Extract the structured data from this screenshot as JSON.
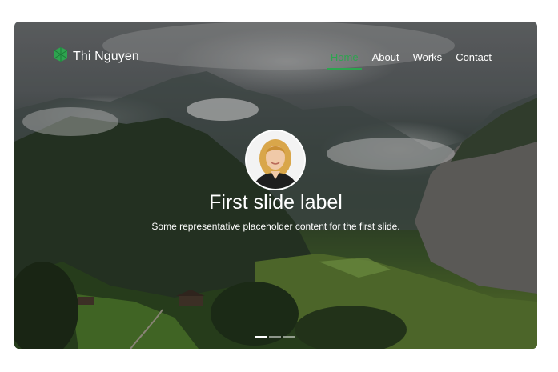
{
  "brand": {
    "name": "Thi Nguyen",
    "logo_icon": "gem-icon",
    "logo_color": "#2ea44f"
  },
  "nav": {
    "items": [
      {
        "label": "Home",
        "active": true
      },
      {
        "label": "About",
        "active": false
      },
      {
        "label": "Works",
        "active": false
      },
      {
        "label": "Contact",
        "active": false
      }
    ],
    "active_color": "#2ea44f"
  },
  "carousel": {
    "slide": {
      "title": "First slide label",
      "text": "Some representative placeholder content for the first slide."
    },
    "indicators": [
      {
        "active": true
      },
      {
        "active": false
      },
      {
        "active": false
      }
    ]
  }
}
